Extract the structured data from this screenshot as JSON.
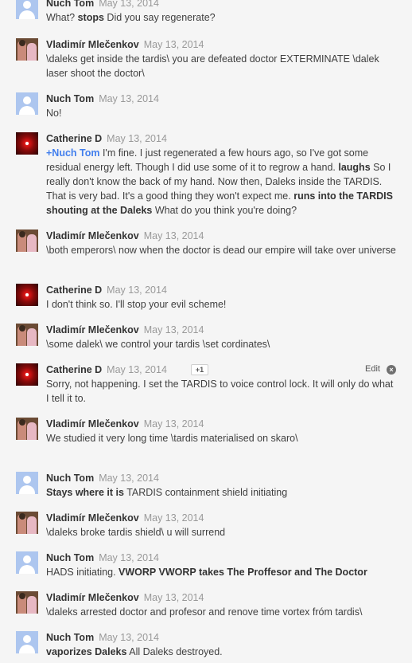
{
  "date": "May 13, 2014",
  "actions": {
    "plus_one": "+1",
    "edit": "Edit",
    "delete_symbol": "×"
  },
  "comments": [
    {
      "author": "Nuch Tom",
      "avatar": "default-person-avatar",
      "parts": [
        {
          "t": "What? "
        },
        {
          "t": "stops",
          "b": true
        },
        {
          "t": " Did you say regenerate?"
        }
      ]
    },
    {
      "author": "Vladimír Mlečenkov",
      "avatar": "photo-avatar",
      "parts": [
        {
          "t": "\\daleks get inside the tardis\\ you are defeated doctor EXTERMINATE \\dalek laser shoot the doctor\\"
        }
      ]
    },
    {
      "author": "Nuch Tom",
      "avatar": "default-person-avatar",
      "parts": [
        {
          "t": "No!"
        }
      ]
    },
    {
      "author": "Catherine D",
      "avatar": "red-light-avatar",
      "parts": [
        {
          "t": "+Nuch Tom",
          "m": true
        },
        {
          "t": " I'm fine. I just regenerated a few hours ago, so I've got some residual energy left. Though I did use some of it to regrow a hand. "
        },
        {
          "t": "laughs",
          "b": true
        },
        {
          "t": " So I really don't know the back of my hand. Now then, Daleks inside the TARDIS. That is very bad. It's a good thing they won't expect me. "
        },
        {
          "t": "runs into the TARDIS shouting at the Daleks",
          "b": true
        },
        {
          "t": " What do you think you're doing?"
        }
      ]
    },
    {
      "author": "Vladimír Mlečenkov",
      "avatar": "photo-avatar",
      "parts": [
        {
          "t": "\\both emperors\\ now when the doctor is dead our empire will take over universe"
        }
      ]
    },
    {
      "author": "Catherine D",
      "avatar": "red-light-avatar",
      "parts": [
        {
          "t": "I don't think so. I'll stop your evil scheme!"
        }
      ]
    },
    {
      "author": "Vladimír Mlečenkov",
      "avatar": "photo-avatar",
      "parts": [
        {
          "t": "\\some dalek\\ we control your tardis \\set cordinates\\"
        }
      ]
    },
    {
      "author": "Catherine D",
      "avatar": "red-light-avatar",
      "own": true,
      "parts": [
        {
          "t": "Sorry, not happening. I set the TARDIS to voice control lock. It will only do what I tell it to."
        }
      ]
    },
    {
      "author": "Vladimír Mlečenkov",
      "avatar": "photo-avatar",
      "parts": [
        {
          "t": "We studied it very long time \\tardis materialised on skaro\\"
        }
      ]
    },
    {
      "author": "Nuch Tom",
      "avatar": "default-person-avatar",
      "parts": [
        {
          "t": "Stays where it is",
          "b": true
        },
        {
          "t": " TARDIS containment shield initiating"
        }
      ]
    },
    {
      "author": "Vladimír Mlečenkov",
      "avatar": "photo-avatar",
      "parts": [
        {
          "t": "\\daleks broke tardis shield\\ u will surrend"
        }
      ]
    },
    {
      "author": "Nuch Tom",
      "avatar": "default-person-avatar",
      "parts": [
        {
          "t": "HADS initiating. "
        },
        {
          "t": "VWORP VWORP takes The Proffesor and The Doctor",
          "b": true
        }
      ]
    },
    {
      "author": "Vladimír Mlečenkov",
      "avatar": "photo-avatar",
      "parts": [
        {
          "t": "\\daleks arrested doctor and profesor and renove time vortex fróm tardis\\"
        }
      ]
    },
    {
      "author": "Nuch Tom",
      "avatar": "default-person-avatar",
      "parts": [
        {
          "t": "vaporizes Daleks",
          "b": true
        },
        {
          "t": " All Daleks destroyed."
        }
      ]
    }
  ]
}
